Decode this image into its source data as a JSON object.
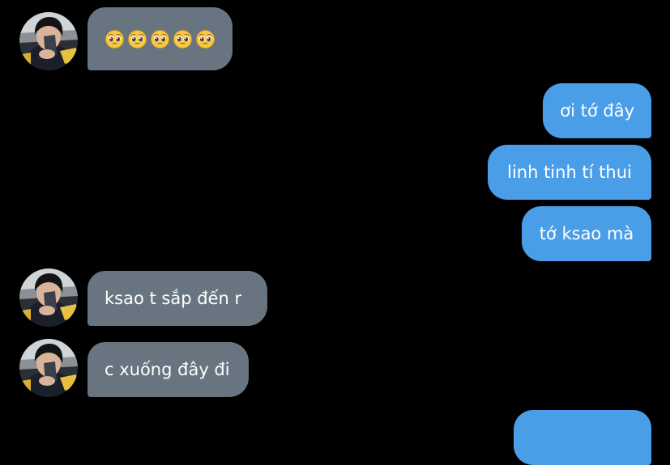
{
  "colors": {
    "background": "#000000",
    "incoming_bubble": "#687580",
    "outgoing_bubble": "#4a9ee8",
    "text": "#ffffff"
  },
  "messages": [
    {
      "direction": "incoming",
      "type": "emoji",
      "emoji_name": "pleading-face-emoji",
      "emoji_count": 5
    },
    {
      "direction": "outgoing",
      "text": "ơi tớ đây"
    },
    {
      "direction": "outgoing",
      "text": "linh tinh tí thui"
    },
    {
      "direction": "outgoing",
      "text": "tớ ksao mà"
    },
    {
      "direction": "incoming",
      "text": "ksao t sắp đến r"
    },
    {
      "direction": "incoming",
      "text": "c xuống đây đi"
    },
    {
      "direction": "outgoing",
      "text": ""
    }
  ],
  "icons": {
    "avatar": "contact-avatar-photo",
    "emoji": "pleading-face-emoji"
  }
}
